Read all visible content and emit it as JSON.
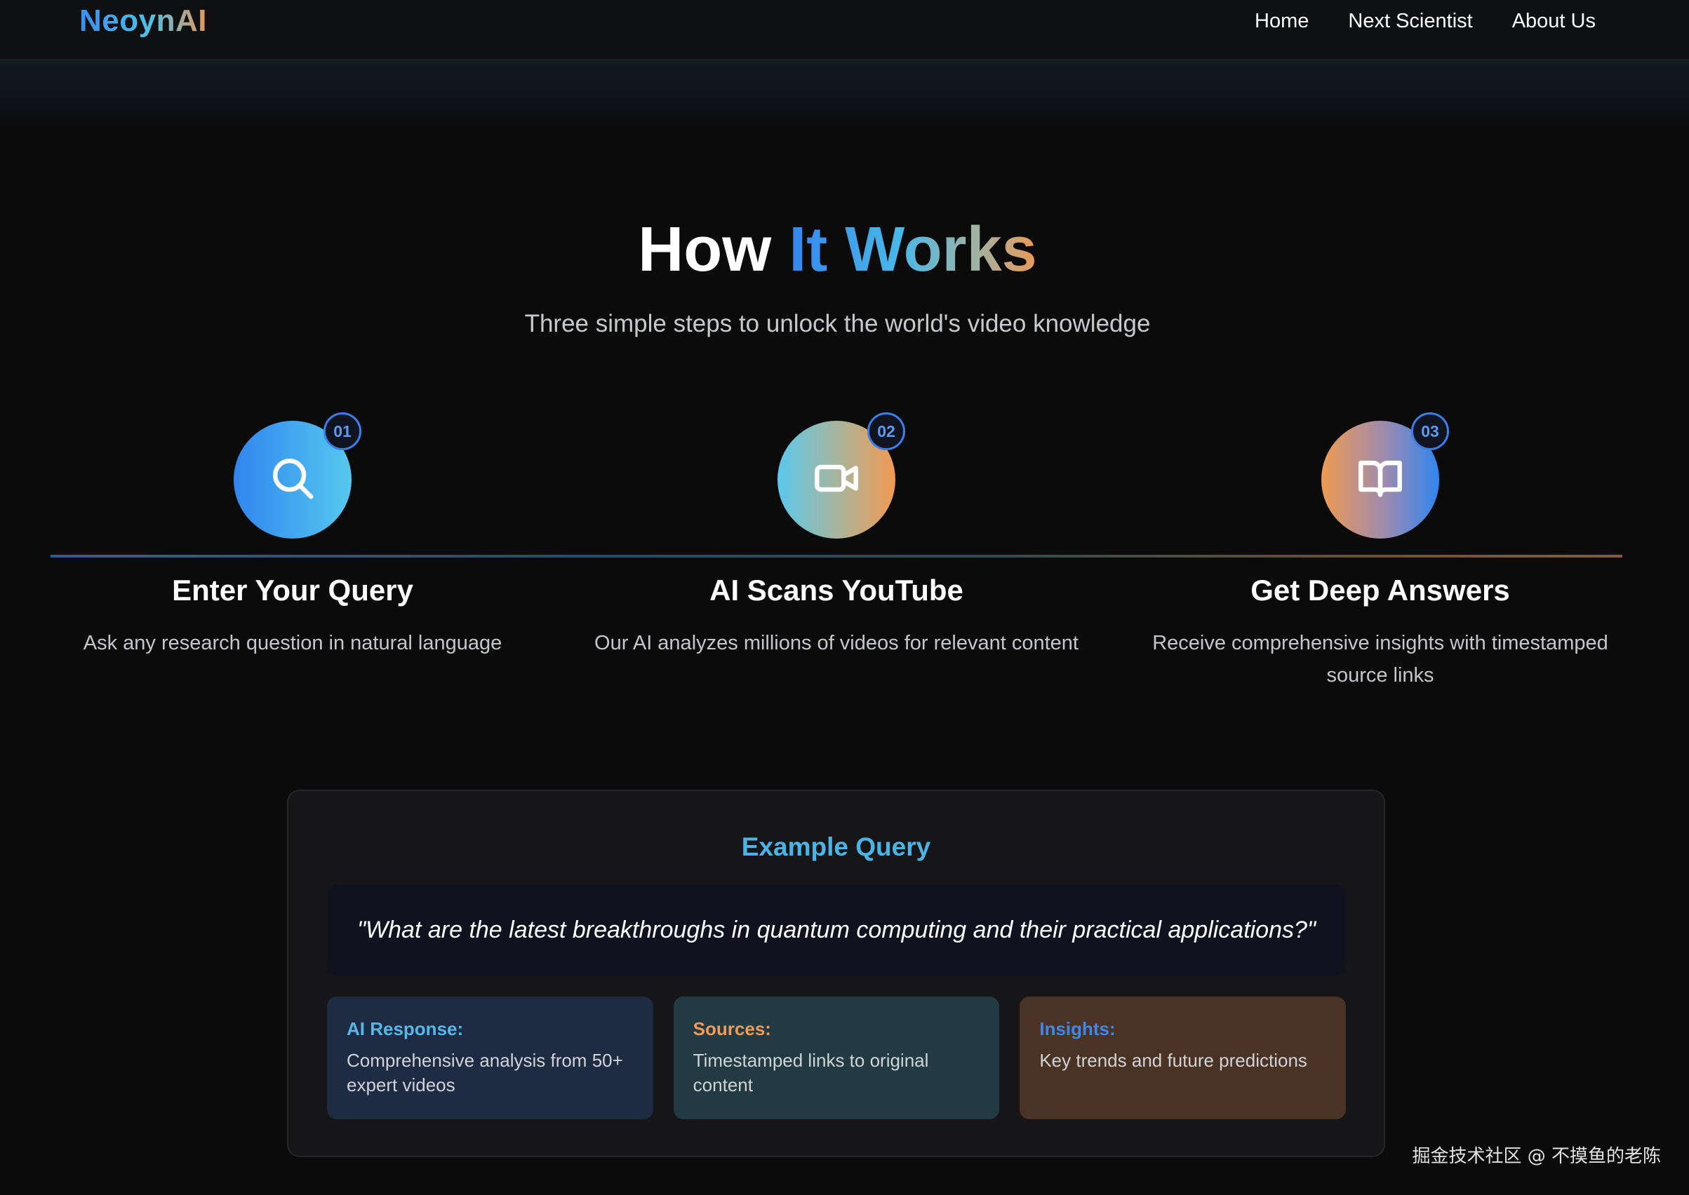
{
  "nav": {
    "brand": "NeoynAI",
    "links": [
      "Home",
      "Next Scientist",
      "About Us"
    ]
  },
  "hero": {
    "title_part1": "How",
    "title_part2": "It Works",
    "subtitle": "Three simple steps to unlock the world's video knowledge"
  },
  "steps": [
    {
      "number": "01",
      "icon": "search-icon",
      "title": "Enter Your Query",
      "description": "Ask any research question in natural language"
    },
    {
      "number": "02",
      "icon": "video-camera-icon",
      "title": "AI Scans YouTube",
      "description": "Our AI analyzes millions of videos for relevant content"
    },
    {
      "number": "03",
      "icon": "open-book-icon",
      "title": "Get Deep Answers",
      "description": "Receive comprehensive insights with timestamped source links"
    }
  ],
  "example": {
    "title": "Example Query",
    "query": "\"What are the latest breakthroughs in quantum computing and their practical applications?\"",
    "cards": [
      {
        "label": "AI Response:",
        "text": "Comprehensive analysis from 50+ expert videos"
      },
      {
        "label": "Sources:",
        "text": "Timestamped links to original content"
      },
      {
        "label": "Insights:",
        "text": "Key trends and future predictions"
      }
    ]
  },
  "watermark": "掘金技术社区 @ 不摸鱼的老陈",
  "colors": {
    "background": "#0b0b0c",
    "accent_blue": "#3586ee",
    "accent_cyan": "#4bb4e4",
    "accent_orange": "#ea9a55"
  }
}
